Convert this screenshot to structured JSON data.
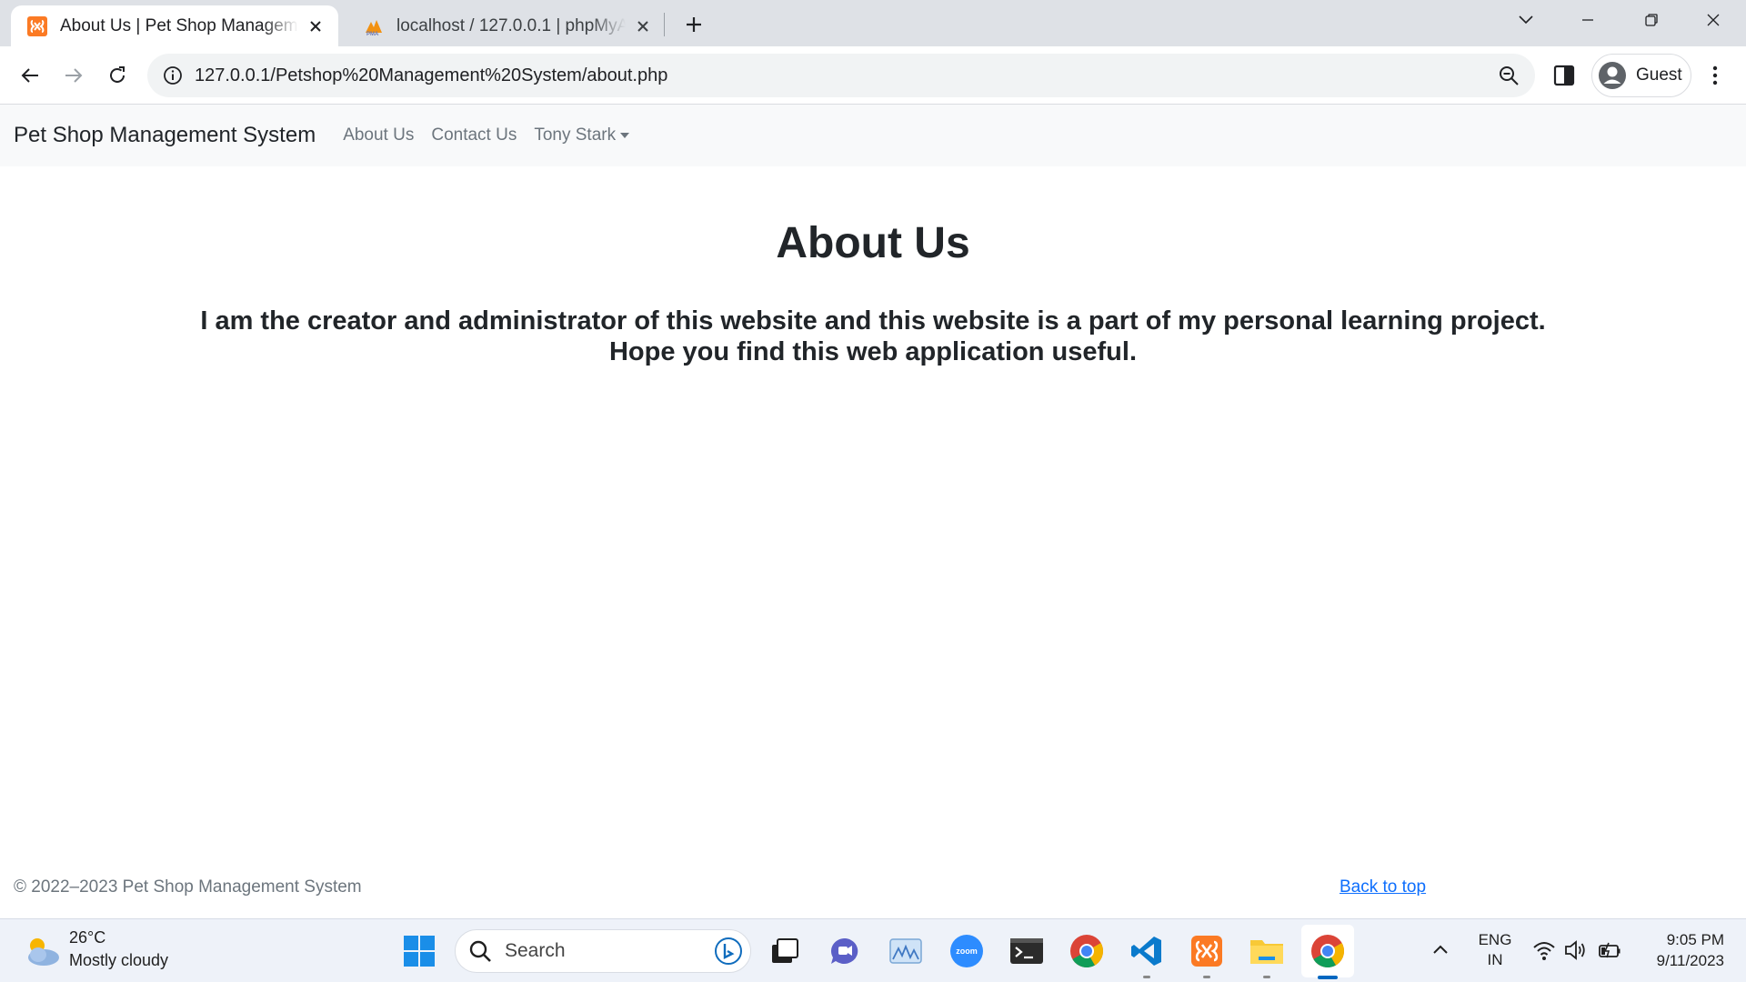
{
  "browser": {
    "tabs": [
      {
        "title": "About Us | Pet Shop Management System",
        "favicon": "xampp-icon",
        "active": true
      },
      {
        "title": "localhost / 127.0.0.1 | phpMyAdmin",
        "favicon": "phpmyadmin-icon",
        "active": false
      }
    ],
    "url": "127.0.0.1/Petshop%20Management%20System/about.php",
    "profile_label": "Guest"
  },
  "site": {
    "brand": "Pet Shop Management System",
    "nav": {
      "about": "About Us",
      "contact": "Contact Us",
      "user": "Tony Stark"
    },
    "heading": "About Us",
    "paragraph_line1": "I am the creator and administrator of this website and this website is a part of my personal learning project.",
    "paragraph_line2": "Hope you find this web application useful.",
    "footer_copyright": "© 2022–2023 Pet Shop Management System",
    "back_to_top": "Back to top"
  },
  "taskbar": {
    "weather_temp": "26°C",
    "weather_desc": "Mostly cloudy",
    "search_placeholder": "Search",
    "lang_line1": "ENG",
    "lang_line2": "IN",
    "time": "9:05 PM",
    "date": "9/11/2023",
    "apps": [
      "windows-start-icon",
      "task-view-icon",
      "teams-chat-icon",
      "photos-icon",
      "zoom-icon",
      "terminal-icon",
      "chrome-icon",
      "vscode-icon",
      "xampp-icon",
      "file-explorer-icon",
      "chrome-icon"
    ]
  },
  "colors": {
    "navbar_bg": "#f8f9fa",
    "link": "#0d6efd",
    "muted": "#6c757d",
    "taskbar_bg": "#eef2f9"
  }
}
